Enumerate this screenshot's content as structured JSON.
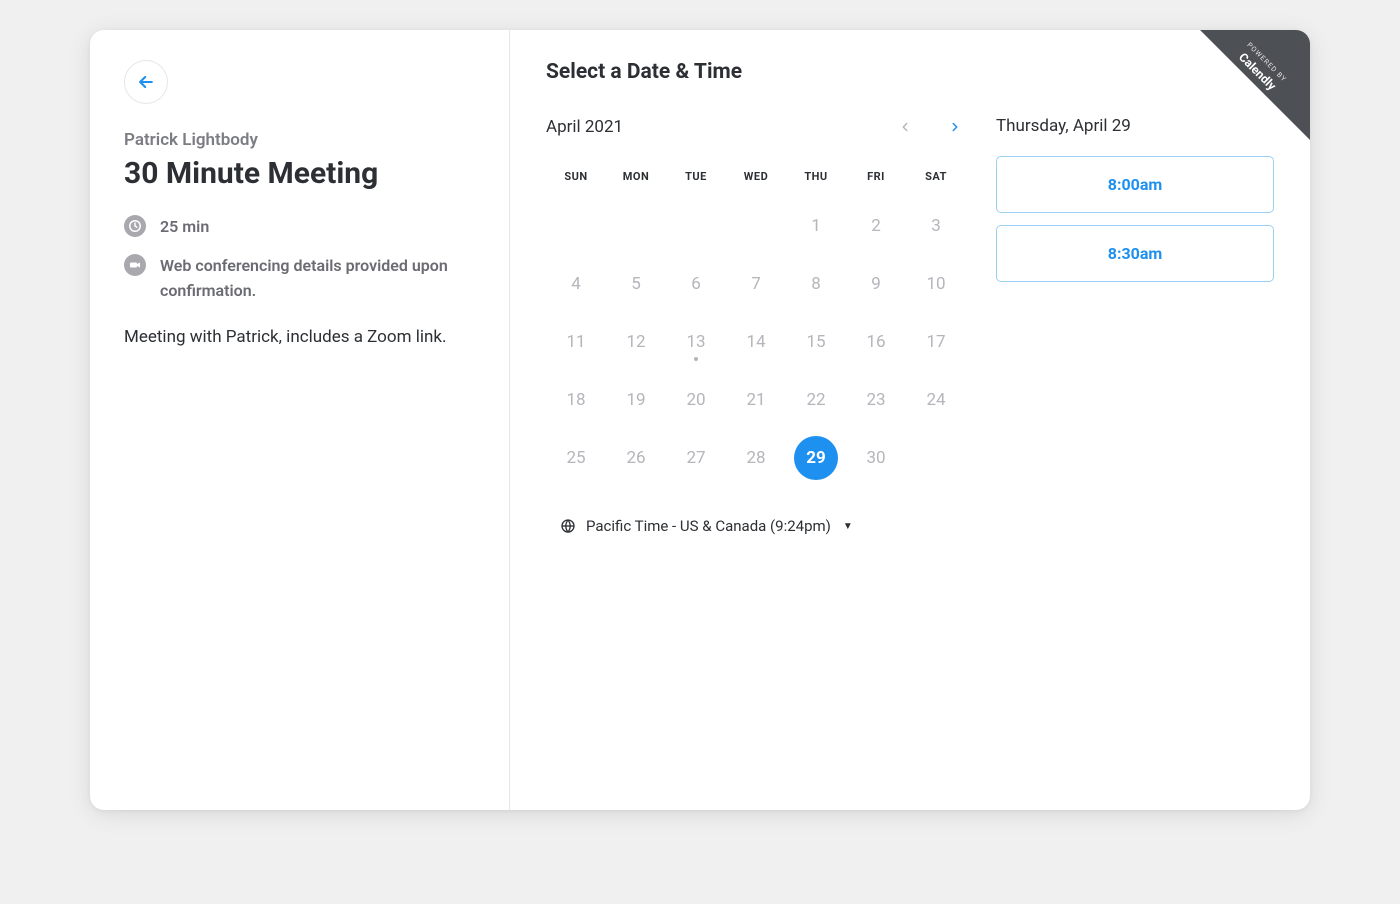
{
  "badge": {
    "powered": "POWERED BY",
    "brand": "Calendly"
  },
  "left": {
    "host": "Patrick Lightbody",
    "title": "30 Minute Meeting",
    "duration": "25 min",
    "conferencing": "Web conferencing details provided upon confirmation.",
    "description": "Meeting with Patrick, includes a Zoom link."
  },
  "right": {
    "heading": "Select a Date & Time",
    "month": "April 2021",
    "dow": [
      "SUN",
      "MON",
      "TUE",
      "WED",
      "THU",
      "FRI",
      "SAT"
    ],
    "weeks": [
      [
        {
          "n": ""
        },
        {
          "n": ""
        },
        {
          "n": ""
        },
        {
          "n": ""
        },
        {
          "n": "1"
        },
        {
          "n": "2"
        },
        {
          "n": "3"
        }
      ],
      [
        {
          "n": "4"
        },
        {
          "n": "5"
        },
        {
          "n": "6"
        },
        {
          "n": "7"
        },
        {
          "n": "8"
        },
        {
          "n": "9"
        },
        {
          "n": "10"
        }
      ],
      [
        {
          "n": "11"
        },
        {
          "n": "12"
        },
        {
          "n": "13",
          "dot": true
        },
        {
          "n": "14"
        },
        {
          "n": "15"
        },
        {
          "n": "16"
        },
        {
          "n": "17"
        }
      ],
      [
        {
          "n": "18"
        },
        {
          "n": "19"
        },
        {
          "n": "20"
        },
        {
          "n": "21"
        },
        {
          "n": "22"
        },
        {
          "n": "23"
        },
        {
          "n": "24"
        }
      ],
      [
        {
          "n": "25"
        },
        {
          "n": "26"
        },
        {
          "n": "27"
        },
        {
          "n": "28"
        },
        {
          "n": "29",
          "selected": true
        },
        {
          "n": "30"
        },
        {
          "n": ""
        }
      ]
    ],
    "timezone": "Pacific Time - US & Canada (9:24pm)",
    "selected_date": "Thursday, April 29",
    "slots": [
      "8:00am",
      "8:30am"
    ]
  },
  "colors": {
    "accent": "#1e90f0"
  }
}
